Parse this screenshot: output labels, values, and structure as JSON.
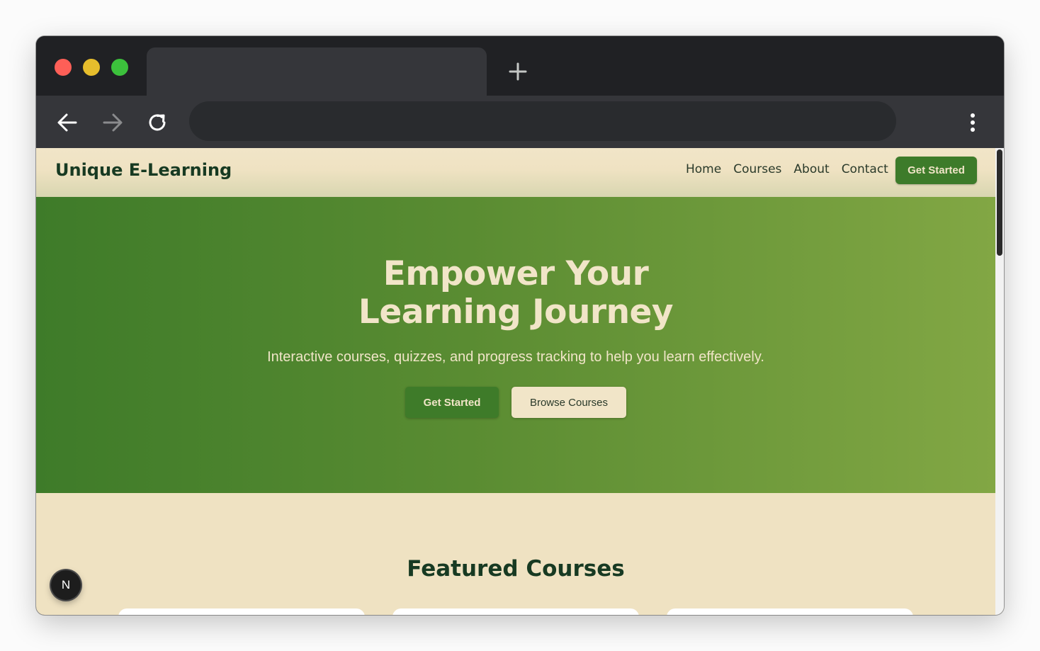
{
  "browser": {
    "icons": {
      "close": "close-dot",
      "minimize": "minimize-dot",
      "maximize": "maximize-dot",
      "new_tab": "plus-icon",
      "back": "back-arrow-icon",
      "forward": "forward-arrow-icon",
      "reload": "reload-icon",
      "menu": "kebab-menu-icon"
    },
    "colors": {
      "close": "#fe5f57",
      "minimize": "#e6bd2c",
      "maximize": "#3cc13c"
    }
  },
  "site": {
    "brand": "Unique E-Learning",
    "nav": {
      "home": "Home",
      "courses": "Courses",
      "about": "About",
      "contact": "Contact"
    },
    "header_cta": "Get Started",
    "colors": {
      "primary": "#3e7b29",
      "cream": "#f1e5c8",
      "dark_green": "#173a22"
    }
  },
  "hero": {
    "title_line1": "Empower Your",
    "title_line2": "Learning Journey",
    "subtitle": "Interactive courses, quizzes, and progress tracking to help you learn effectively.",
    "primary_button": "Get Started",
    "secondary_button": "Browse Courses"
  },
  "featured": {
    "title": "Featured Courses"
  },
  "dev_badge": {
    "letter": "N"
  }
}
